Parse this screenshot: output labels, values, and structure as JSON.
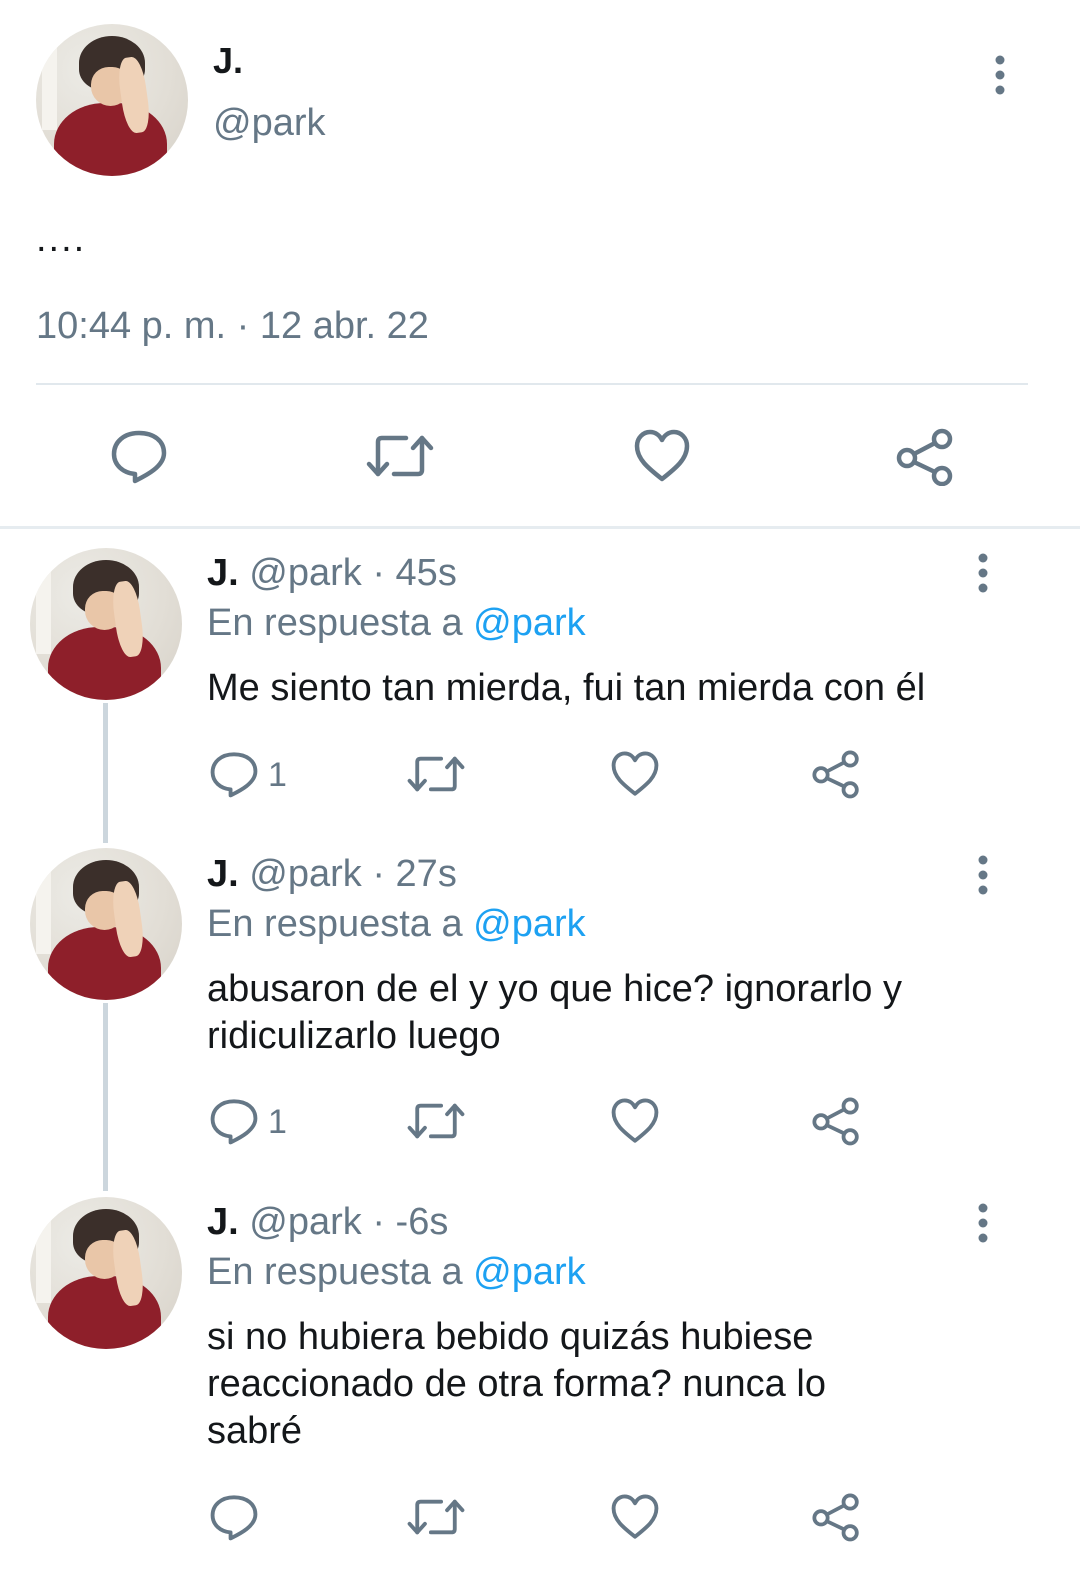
{
  "main_tweet": {
    "name": "J.",
    "handle": "@park",
    "text": "....",
    "timestamp": "10:44 p. m. · 12 abr. 22",
    "actions": [
      "reply-icon",
      "retweet-icon",
      "like-icon",
      "share-icon"
    ]
  },
  "replies": [
    {
      "name": "J.",
      "handle": "@park",
      "dot": "·",
      "time": "45s",
      "reply_prefix": "En respuesta a",
      "reply_to": "@park",
      "text": "Me siento tan mierda, fui tan mierda con él",
      "reply_count": "1"
    },
    {
      "name": "J.",
      "handle": "@park",
      "dot": "·",
      "time": "27s",
      "reply_prefix": "En respuesta a",
      "reply_to": "@park",
      "text": "abusaron de el y yo que hice? ignorarlo y ridiculizarlo luego",
      "reply_count": "1"
    },
    {
      "name": "J.",
      "handle": "@park",
      "dot": "·",
      "time": "-6s",
      "reply_prefix": "En respuesta a",
      "reply_to": "@park",
      "text": "si no hubiera bebido quizás hubiese reaccionado de otra forma? nunca lo sabré",
      "reply_count": ""
    }
  ],
  "colors": {
    "text": "#14171a",
    "secondary": "#657786",
    "accent": "#1da1f2",
    "divider": "#e1e8ed",
    "thread_line": "#ccd6dd"
  }
}
